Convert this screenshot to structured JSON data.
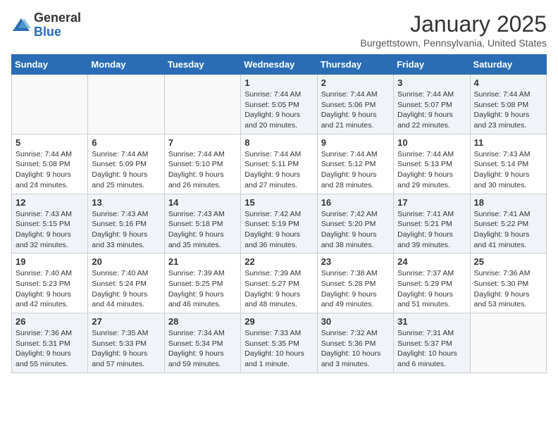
{
  "header": {
    "logo_general": "General",
    "logo_blue": "Blue",
    "month_title": "January 2025",
    "subtitle": "Burgettstown, Pennsylvania, United States"
  },
  "days_of_week": [
    "Sunday",
    "Monday",
    "Tuesday",
    "Wednesday",
    "Thursday",
    "Friday",
    "Saturday"
  ],
  "weeks": [
    [
      {
        "day": "",
        "info": ""
      },
      {
        "day": "",
        "info": ""
      },
      {
        "day": "",
        "info": ""
      },
      {
        "day": "1",
        "info": "Sunrise: 7:44 AM\nSunset: 5:05 PM\nDaylight: 9 hours\nand 20 minutes."
      },
      {
        "day": "2",
        "info": "Sunrise: 7:44 AM\nSunset: 5:06 PM\nDaylight: 9 hours\nand 21 minutes."
      },
      {
        "day": "3",
        "info": "Sunrise: 7:44 AM\nSunset: 5:07 PM\nDaylight: 9 hours\nand 22 minutes."
      },
      {
        "day": "4",
        "info": "Sunrise: 7:44 AM\nSunset: 5:08 PM\nDaylight: 9 hours\nand 23 minutes."
      }
    ],
    [
      {
        "day": "5",
        "info": "Sunrise: 7:44 AM\nSunset: 5:08 PM\nDaylight: 9 hours\nand 24 minutes."
      },
      {
        "day": "6",
        "info": "Sunrise: 7:44 AM\nSunset: 5:09 PM\nDaylight: 9 hours\nand 25 minutes."
      },
      {
        "day": "7",
        "info": "Sunrise: 7:44 AM\nSunset: 5:10 PM\nDaylight: 9 hours\nand 26 minutes."
      },
      {
        "day": "8",
        "info": "Sunrise: 7:44 AM\nSunset: 5:11 PM\nDaylight: 9 hours\nand 27 minutes."
      },
      {
        "day": "9",
        "info": "Sunrise: 7:44 AM\nSunset: 5:12 PM\nDaylight: 9 hours\nand 28 minutes."
      },
      {
        "day": "10",
        "info": "Sunrise: 7:44 AM\nSunset: 5:13 PM\nDaylight: 9 hours\nand 29 minutes."
      },
      {
        "day": "11",
        "info": "Sunrise: 7:43 AM\nSunset: 5:14 PM\nDaylight: 9 hours\nand 30 minutes."
      }
    ],
    [
      {
        "day": "12",
        "info": "Sunrise: 7:43 AM\nSunset: 5:15 PM\nDaylight: 9 hours\nand 32 minutes."
      },
      {
        "day": "13",
        "info": "Sunrise: 7:43 AM\nSunset: 5:16 PM\nDaylight: 9 hours\nand 33 minutes."
      },
      {
        "day": "14",
        "info": "Sunrise: 7:43 AM\nSunset: 5:18 PM\nDaylight: 9 hours\nand 35 minutes."
      },
      {
        "day": "15",
        "info": "Sunrise: 7:42 AM\nSunset: 5:19 PM\nDaylight: 9 hours\nand 36 minutes."
      },
      {
        "day": "16",
        "info": "Sunrise: 7:42 AM\nSunset: 5:20 PM\nDaylight: 9 hours\nand 38 minutes."
      },
      {
        "day": "17",
        "info": "Sunrise: 7:41 AM\nSunset: 5:21 PM\nDaylight: 9 hours\nand 39 minutes."
      },
      {
        "day": "18",
        "info": "Sunrise: 7:41 AM\nSunset: 5:22 PM\nDaylight: 9 hours\nand 41 minutes."
      }
    ],
    [
      {
        "day": "19",
        "info": "Sunrise: 7:40 AM\nSunset: 5:23 PM\nDaylight: 9 hours\nand 42 minutes."
      },
      {
        "day": "20",
        "info": "Sunrise: 7:40 AM\nSunset: 5:24 PM\nDaylight: 9 hours\nand 44 minutes."
      },
      {
        "day": "21",
        "info": "Sunrise: 7:39 AM\nSunset: 5:25 PM\nDaylight: 9 hours\nand 46 minutes."
      },
      {
        "day": "22",
        "info": "Sunrise: 7:39 AM\nSunset: 5:27 PM\nDaylight: 9 hours\nand 48 minutes."
      },
      {
        "day": "23",
        "info": "Sunrise: 7:38 AM\nSunset: 5:28 PM\nDaylight: 9 hours\nand 49 minutes."
      },
      {
        "day": "24",
        "info": "Sunrise: 7:37 AM\nSunset: 5:29 PM\nDaylight: 9 hours\nand 51 minutes."
      },
      {
        "day": "25",
        "info": "Sunrise: 7:36 AM\nSunset: 5:30 PM\nDaylight: 9 hours\nand 53 minutes."
      }
    ],
    [
      {
        "day": "26",
        "info": "Sunrise: 7:36 AM\nSunset: 5:31 PM\nDaylight: 9 hours\nand 55 minutes."
      },
      {
        "day": "27",
        "info": "Sunrise: 7:35 AM\nSunset: 5:33 PM\nDaylight: 9 hours\nand 57 minutes."
      },
      {
        "day": "28",
        "info": "Sunrise: 7:34 AM\nSunset: 5:34 PM\nDaylight: 9 hours\nand 59 minutes."
      },
      {
        "day": "29",
        "info": "Sunrise: 7:33 AM\nSunset: 5:35 PM\nDaylight: 10 hours\nand 1 minute."
      },
      {
        "day": "30",
        "info": "Sunrise: 7:32 AM\nSunset: 5:36 PM\nDaylight: 10 hours\nand 3 minutes."
      },
      {
        "day": "31",
        "info": "Sunrise: 7:31 AM\nSunset: 5:37 PM\nDaylight: 10 hours\nand 6 minutes."
      },
      {
        "day": "",
        "info": ""
      }
    ]
  ]
}
